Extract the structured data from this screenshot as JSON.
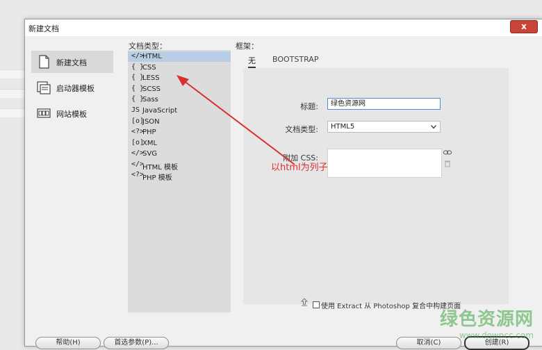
{
  "dialog": {
    "title": "新建文档",
    "close_glyph": "x"
  },
  "sidebar": {
    "items": [
      {
        "label": "新建文档",
        "icon": "new-document-icon",
        "active": true
      },
      {
        "label": "启动器模板",
        "icon": "starter-templates-icon",
        "active": false
      },
      {
        "label": "网站模板",
        "icon": "site-templates-icon",
        "active": false
      }
    ]
  },
  "doc_types": {
    "header": "文档类型：",
    "items": [
      {
        "icon_glyph": "</>",
        "label": "HTML"
      },
      {
        "icon_glyph": "{ }",
        "label": "CSS"
      },
      {
        "icon_glyph": "{ }",
        "label": "LESS"
      },
      {
        "icon_glyph": "{ }",
        "label": "SCSS"
      },
      {
        "icon_glyph": "{ }",
        "label": "Sass"
      },
      {
        "icon_glyph": "JS",
        "label": "JavaScript"
      },
      {
        "icon_glyph": "[o]",
        "label": "JSON"
      },
      {
        "icon_glyph": "<?>",
        "label": "PHP"
      },
      {
        "icon_glyph": "[o]",
        "label": "XML"
      },
      {
        "icon_glyph": "</>",
        "label": "SVG"
      },
      {
        "icon_glyph": "</>",
        "label": "HTML 模板"
      },
      {
        "icon_glyph": "<?>",
        "label": "PHP 模板"
      }
    ]
  },
  "framework": {
    "header": "框架：",
    "tabs": [
      {
        "label": "无",
        "active": true
      },
      {
        "label": "BOOTSTRAP",
        "active": false
      }
    ],
    "title_label": "标题:",
    "title_value": "绿色资源网",
    "doctype_label": "文档类型:",
    "doctype_value": "HTML5",
    "css_label": "附加 CSS:",
    "extract_label": "使用 Extract 从 Photoshop 复合中构建页面"
  },
  "annotation": "以html为列子",
  "buttons": {
    "help": "帮助(H)",
    "prefs": "首选参数(P)...",
    "cancel": "取消(C)",
    "create": "创建(R)"
  },
  "watermark": {
    "main": "绿色资源网",
    "sub": "www.downcc.com"
  },
  "colors": {
    "selection": "#b9cde4",
    "annotation": "#d9302f",
    "close": "#c94338"
  }
}
